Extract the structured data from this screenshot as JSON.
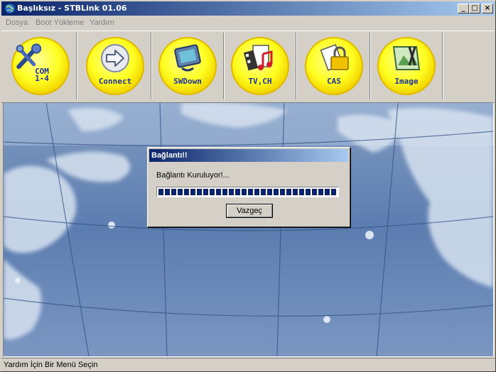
{
  "window": {
    "title": "Başlıksız - STBLink 01.06",
    "controls": {
      "minimize": "_",
      "maximize": "□",
      "close": "×"
    }
  },
  "menu": {
    "items": [
      {
        "label": "Dosya"
      },
      {
        "label": "Boot Yükleme"
      },
      {
        "label": "Yardım"
      }
    ]
  },
  "toolbar": {
    "buttons": [
      {
        "label": "COM 1-4",
        "icon": "wrench-icon",
        "line1": "COM",
        "line2": "1-4"
      },
      {
        "label": "Connect",
        "icon": "arrow-right-icon"
      },
      {
        "label": "SWDown",
        "icon": "monitor-icon"
      },
      {
        "label": "TV,CH",
        "icon": "media-icon"
      },
      {
        "label": "CAS",
        "icon": "lock-icon"
      },
      {
        "label": "Image",
        "icon": "image-icon"
      }
    ]
  },
  "dialog": {
    "title": "Bağlantı!!",
    "message": "Bağlantı Kuruluyor!...",
    "progress": 1.0,
    "cancel_label": "Vazgeç"
  },
  "status": {
    "text": "Yardım İçin Bir Menü Seçin"
  },
  "colors": {
    "titlebar_start": "#0a246a",
    "titlebar_end": "#a6caf0",
    "toolbar_disc": "#ffff22",
    "toolbar_label": "#1e2f9e",
    "progress": "#0a246a"
  }
}
